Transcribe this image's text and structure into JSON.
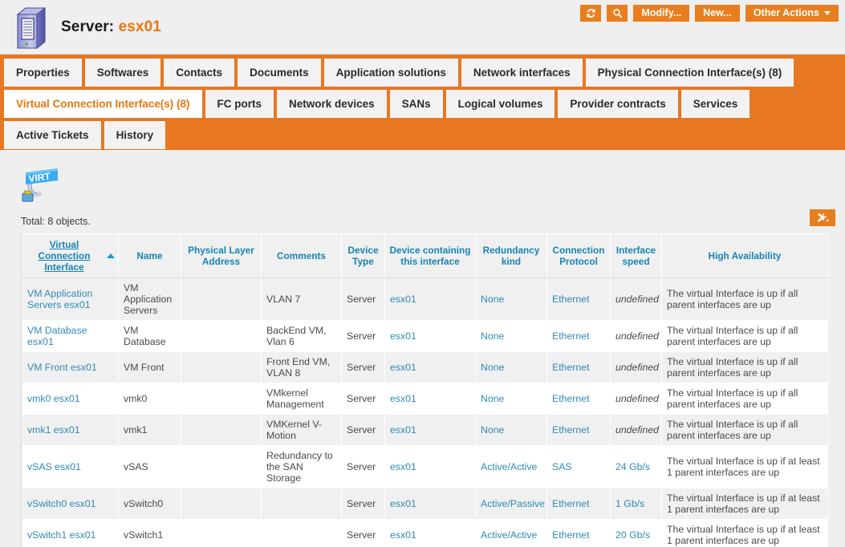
{
  "header": {
    "icon": "server-tower-icon",
    "label": "Server:",
    "object_name": "esx01",
    "actions": {
      "refresh": {
        "icon": "refresh-icon",
        "label": ""
      },
      "search": {
        "icon": "search-icon",
        "label": ""
      },
      "modify": "Modify...",
      "new": "New...",
      "other_actions": "Other Actions"
    }
  },
  "tabs": {
    "row1": [
      {
        "label": "Properties",
        "active": false
      },
      {
        "label": "Softwares",
        "active": false
      },
      {
        "label": "Contacts",
        "active": false
      },
      {
        "label": "Documents",
        "active": false
      },
      {
        "label": "Application solutions",
        "active": false
      },
      {
        "label": "Network interfaces",
        "active": false
      },
      {
        "label": "Physical Connection Interface(s) (8)",
        "active": false
      }
    ],
    "row2": [
      {
        "label": "Virtual Connection Interface(s) (8)",
        "active": true
      },
      {
        "label": "FC ports",
        "active": false
      },
      {
        "label": "Network devices",
        "active": false
      },
      {
        "label": "SANs",
        "active": false
      },
      {
        "label": "Logical volumes",
        "active": false
      },
      {
        "label": "Provider contracts",
        "active": false
      },
      {
        "label": "Services",
        "active": false
      }
    ],
    "row3": [
      {
        "label": "Active Tickets",
        "active": false
      },
      {
        "label": "History",
        "active": false
      }
    ]
  },
  "panel": {
    "logo_icon": "virt-network-cable-icon",
    "logo_text": "VIRT",
    "total_text": "Total: 8 objects.",
    "export_icon": "tools-dropdown-icon"
  },
  "table": {
    "columns": [
      {
        "label": "Virtual Connection Interface",
        "sortable": true,
        "sorted": "asc"
      },
      {
        "label": "Name",
        "sortable": false,
        "sorted": ""
      },
      {
        "label": "Physical Layer Address",
        "sortable": false,
        "sorted": ""
      },
      {
        "label": "Comments",
        "sortable": false,
        "sorted": ""
      },
      {
        "label": "Device Type",
        "sortable": false,
        "sorted": ""
      },
      {
        "label": "Device containing this interface",
        "sortable": false,
        "sorted": ""
      },
      {
        "label": "Redundancy kind",
        "sortable": false,
        "sorted": ""
      },
      {
        "label": "Connection Protocol",
        "sortable": false,
        "sorted": ""
      },
      {
        "label": "Interface speed",
        "sortable": false,
        "sorted": ""
      },
      {
        "label": "High Availability",
        "sortable": false,
        "sorted": ""
      }
    ],
    "rows": [
      {
        "vci": "VM Application Servers esx01",
        "name": "VM Application Servers",
        "phy": "",
        "comments": "VLAN 7",
        "device_type": "Server",
        "device": "esx01",
        "redundancy": "None",
        "protocol": "Ethernet",
        "speed": "undefined",
        "ha": "The virtual Interface is up if all parent interfaces are up"
      },
      {
        "vci": "VM Database esx01",
        "name": "VM Database",
        "phy": "",
        "comments": "BackEnd VM, Vlan 6",
        "device_type": "Server",
        "device": "esx01",
        "redundancy": "None",
        "protocol": "Ethernet",
        "speed": "undefined",
        "ha": "The virtual Interface is up if all parent interfaces are up"
      },
      {
        "vci": "VM Front esx01",
        "name": "VM Front",
        "phy": "",
        "comments": "Front End VM, VLAN 8",
        "device_type": "Server",
        "device": "esx01",
        "redundancy": "None",
        "protocol": "Ethernet",
        "speed": "undefined",
        "ha": "The virtual Interface is up if all parent interfaces are up"
      },
      {
        "vci": "vmk0 esx01",
        "name": "vmk0",
        "phy": "",
        "comments": "VMkernel Management",
        "device_type": "Server",
        "device": "esx01",
        "redundancy": "None",
        "protocol": "Ethernet",
        "speed": "undefined",
        "ha": "The virtual Interface is up if all parent interfaces are up"
      },
      {
        "vci": "vmk1 esx01",
        "name": "vmk1",
        "phy": "",
        "comments": "VMKernel V-Motion",
        "device_type": "Server",
        "device": "esx01",
        "redundancy": "None",
        "protocol": "Ethernet",
        "speed": "undefined",
        "ha": "The virtual Interface is up if all parent interfaces are up"
      },
      {
        "vci": "vSAS esx01",
        "name": "vSAS",
        "phy": "",
        "comments": "Redundancy to the SAN Storage",
        "device_type": "Server",
        "device": "esx01",
        "redundancy": "Active/Active",
        "protocol": "SAS",
        "speed": "24 Gb/s",
        "ha": "The virtual Interface is up if at least 1 parent interfaces are up"
      },
      {
        "vci": "vSwitch0 esx01",
        "name": "vSwitch0",
        "phy": "",
        "comments": "",
        "device_type": "Server",
        "device": "esx01",
        "redundancy": "Active/Passive",
        "protocol": "Ethernet",
        "speed": "1 Gb/s",
        "ha": "The virtual Interface is up if at least 1 parent interfaces are up"
      },
      {
        "vci": "vSwitch1 esx01",
        "name": "vSwitch1",
        "phy": "",
        "comments": "",
        "device_type": "Server",
        "device": "esx01",
        "redundancy": "Active/Active",
        "protocol": "Ethernet",
        "speed": "20 Gb/s",
        "ha": "The virtual Interface is up if at least 1 parent interfaces are up"
      }
    ]
  },
  "colors": {
    "brand_orange": "#e87722",
    "button_orange": "#e87e1e",
    "link_blue": "#2e8ab8",
    "header_blue": "#1684b4",
    "page_bg": "#efefef",
    "row_alt": "#f0f0f0"
  }
}
